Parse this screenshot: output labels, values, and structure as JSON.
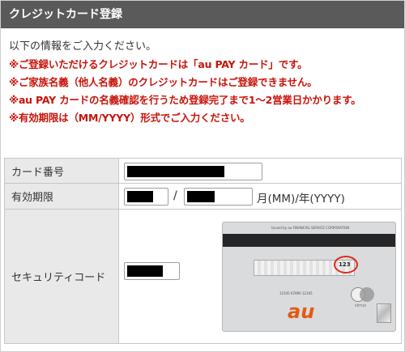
{
  "header": {
    "title": "クレジットカード登録"
  },
  "intro": {
    "lead": "以下の情報をご入力ください。",
    "warnings": [
      "※ご登録いただけるクレジットカードは「au PAY カード」です。",
      "※ご家族名義（他人名義）のクレジットカードはご登録できません。",
      "※au PAY カードの名義確認を行うため登録完了まで1～2営業日かかります。",
      "※有効期限は（MM/YYYY）形式でご入力ください。"
    ]
  },
  "form": {
    "card_number": {
      "label": "カード番号",
      "value": ""
    },
    "expiry": {
      "label": "有効期限",
      "month_value": "",
      "year_value": "",
      "separator": "/",
      "format_hint": "月(MM)/年(YYYY)"
    },
    "security_code": {
      "label": "セキュリティコード",
      "value": ""
    }
  },
  "card_image": {
    "issuer_line": "Issued by au FINANCIAL SERVICE CORPORATION",
    "cvv_digits": "123",
    "brand": "au",
    "network_label": "cirrus",
    "number_fragment": "12345 67890 12345"
  },
  "colors": {
    "header_bg": "#5a5a5a",
    "warning_text": "#c8140a",
    "label_bg": "#e9e9e9",
    "cvv_circle": "#e0281b"
  }
}
